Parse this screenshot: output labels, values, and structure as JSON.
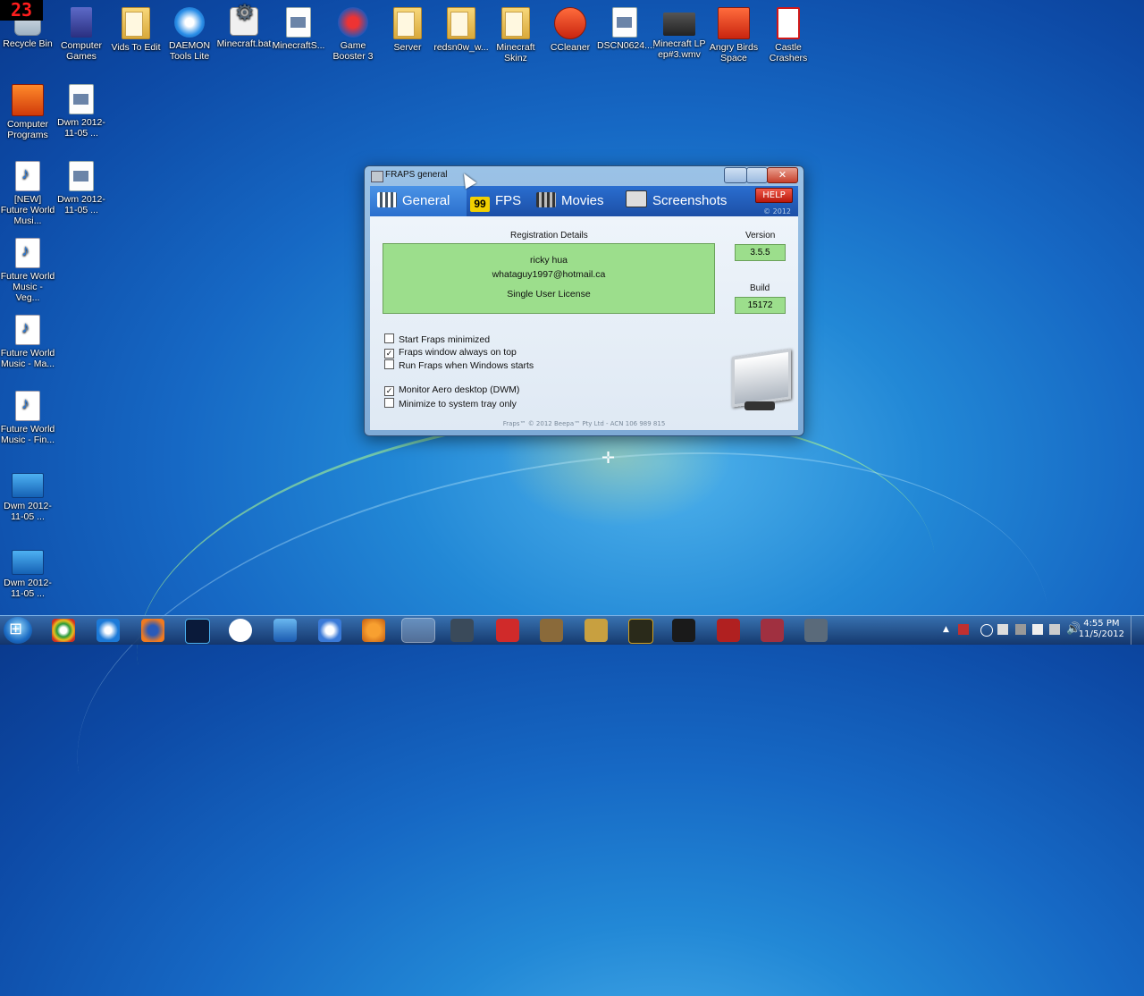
{
  "fps_counter": "23",
  "desktop_icons": [
    {
      "label": "Recycle Bin",
      "icon": "recycle-bin-icon"
    },
    {
      "label": "Computer Games",
      "icon": "game-icon"
    },
    {
      "label": "Vids To Edit",
      "icon": "folder-icon"
    },
    {
      "label": "DAEMON Tools Lite",
      "icon": "daemon-tools-icon"
    },
    {
      "label": "Minecraft.bat",
      "icon": "batch-file-icon"
    },
    {
      "label": "MinecraftS...",
      "icon": "file-icon"
    },
    {
      "label": "Game Booster 3",
      "icon": "game-booster-icon"
    },
    {
      "label": "Server",
      "icon": "folder-icon"
    },
    {
      "label": "redsn0w_w...",
      "icon": "folder-icon"
    },
    {
      "label": "Minecraft Skinz",
      "icon": "folder-icon"
    },
    {
      "label": "CCleaner",
      "icon": "ccleaner-icon"
    },
    {
      "label": "DSCN0624....",
      "icon": "video-file-icon"
    },
    {
      "label": "Minecraft LP ep#3.wmv",
      "icon": "video-file-icon"
    },
    {
      "label": "Angry Birds Space",
      "icon": "angry-birds-icon"
    },
    {
      "label": "Castle Crashers",
      "icon": "castle-crashers-icon"
    },
    {
      "label": "Computer Programs",
      "icon": "programs-icon"
    },
    {
      "label": "Dwm 2012-11-05 ...",
      "icon": "video-file-icon"
    },
    {
      "label": "[NEW] Future World Musi...",
      "icon": "mp3-file-icon"
    },
    {
      "label": "Dwm 2012-11-05 ...",
      "icon": "video-file-icon"
    },
    {
      "label": "Future World Music - Veg...",
      "icon": "mp3-file-icon"
    },
    {
      "label": "Future World Music - Ma...",
      "icon": "mp3-file-icon"
    },
    {
      "label": "Future World Music - Fin...",
      "icon": "mp3-file-icon"
    },
    {
      "label": "Dwm 2012-11-05 ...",
      "icon": "media-file-icon"
    },
    {
      "label": "Dwm 2012-11-05 ...",
      "icon": "media-file-icon"
    }
  ],
  "window": {
    "title": "FRAPS general",
    "tabs": [
      {
        "label": "General",
        "icon": "grid-icon"
      },
      {
        "label": "FPS",
        "icon": "fps-icon",
        "badge": "99"
      },
      {
        "label": "Movies",
        "icon": "film-icon"
      },
      {
        "label": "Screenshots",
        "icon": "camera-icon"
      }
    ],
    "help_label": "HELP",
    "corner_copyright": "© 2012",
    "registration": {
      "heading": "Registration Details",
      "name": "ricky hua",
      "email": "whataguy1997@hotmail.ca",
      "license": "Single User License"
    },
    "version_label": "Version",
    "version": "3.5.5",
    "build_label": "Build",
    "build": "15172",
    "options": [
      {
        "label": "Start Fraps minimized",
        "checked": false
      },
      {
        "label": "Fraps window always on top",
        "checked": true
      },
      {
        "label": "Run Fraps when Windows starts",
        "checked": false
      },
      {
        "label": "Monitor Aero desktop (DWM)",
        "checked": true
      },
      {
        "label": "Minimize to system tray only",
        "checked": false
      }
    ],
    "footer": "Fraps™ © 2012 Beepa™ Pty Ltd - ACN 106 989 815"
  },
  "taskbar": {
    "apps": [
      "chrome-icon",
      "internet-explorer-icon",
      "firefox-icon",
      "photoshop-icon",
      "chat-icon",
      "media-player-icon",
      "itunes-icon",
      "vlc-icon",
      "fraps-icon",
      "app-icon",
      "four-icon",
      "game-icon",
      "game-icon",
      "game-icon",
      "aion-icon",
      "game-icon",
      "game-icon",
      "game-icon"
    ],
    "active_app": "fraps-icon",
    "time": "4:55 PM",
    "date": "11/5/2012"
  },
  "colors": {
    "desktop_blue": "#1668c4",
    "reg_green": "#9cde8c",
    "tab_blue": "#1c4fa6",
    "help_red": "#d02a1a",
    "counter_red": "#ff1d1d"
  }
}
